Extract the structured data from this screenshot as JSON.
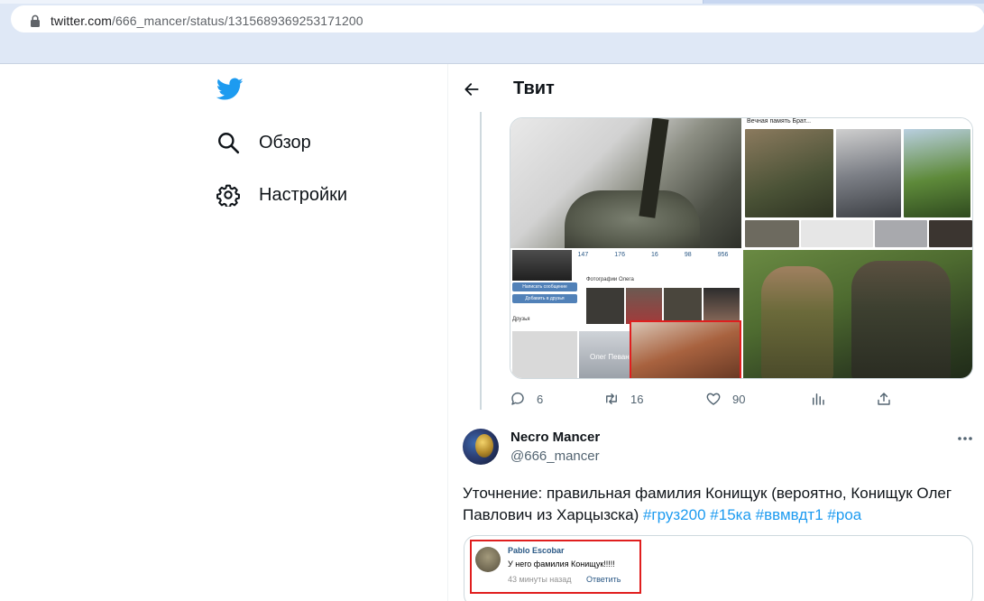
{
  "browser": {
    "url_host": "twitter.com",
    "url_path": "/666_mancer/status/1315689369253171200"
  },
  "nav": {
    "items": [
      {
        "label": "Обзор",
        "icon": "search-icon"
      },
      {
        "label": "Настройки",
        "icon": "gear-icon"
      }
    ]
  },
  "header": {
    "title": "Твит"
  },
  "media": {
    "vk_title": "Вечная память Брат...",
    "vk_stats": [
      "147",
      "176",
      "16",
      "98",
      "956"
    ],
    "vk_btn_message": "Написать сообщение",
    "vk_btn_add": "Добавить в друзья",
    "vk_photos_label": "Фотографии Олега",
    "vk_friends_label": "Друзья",
    "vk_person_name": "Олег Певан"
  },
  "actions": {
    "replies": "6",
    "retweets": "16",
    "likes": "90"
  },
  "tweet": {
    "display_name": "Necro Mancer",
    "handle": "@666_mancer",
    "text_plain": "Уточнение: правильная фамилия Конищук (вероятно, Конищук Олег Павлович из Харцызска) ",
    "hashtags": [
      "#груз200",
      "#15ка",
      "#ввмвдт1",
      "#роа"
    ]
  },
  "embed": {
    "name": "Pablo Escobar",
    "message": "У него фамилия Конищук!!!!!",
    "time": "43 минуты назад",
    "reply": "Ответить"
  },
  "colors": {
    "accent": "#1d9bf0",
    "text": "#0f1419",
    "muted": "#536471",
    "chrome": "#dfe8f6",
    "highlight_red": "#e01e1e"
  }
}
